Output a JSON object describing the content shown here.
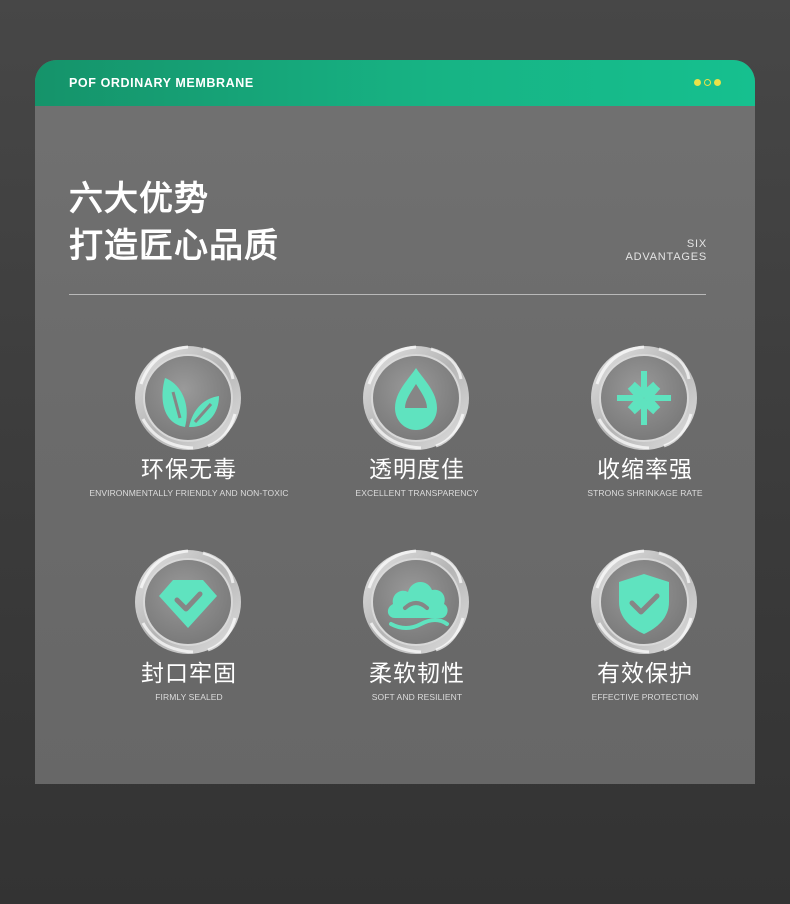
{
  "header": {
    "title": "POF ORDINARY MEMBRANE"
  },
  "headline": {
    "line1": "六大优势",
    "line2": "打造匠心品质"
  },
  "side_label": {
    "line1": "SIX",
    "line2": "ADVANTAGES"
  },
  "colors": {
    "accent": "#5fe3bf",
    "header": "#17b384",
    "dot": "#e8e24a"
  },
  "advantages": [
    {
      "icon": "leaf-icon",
      "title": "环保无毒",
      "subtitle": "ENVIRONMENTALLY FRIENDLY AND NON-TOXIC"
    },
    {
      "icon": "water-drop-icon",
      "title": "透明度佳",
      "subtitle": "EXCELLENT TRANSPARENCY"
    },
    {
      "icon": "shrink-arrows-icon",
      "title": "收缩率强",
      "subtitle": "STRONG SHRINKAGE RATE"
    },
    {
      "icon": "diamond-check-icon",
      "title": "封口牢固",
      "subtitle": "FIRMLY SEALED"
    },
    {
      "icon": "cloud-icon",
      "title": "柔软韧性",
      "subtitle": "SOFT AND RESILIENT"
    },
    {
      "icon": "shield-check-icon",
      "title": "有效保护",
      "subtitle": "EFFECTIVE PROTECTION"
    }
  ]
}
